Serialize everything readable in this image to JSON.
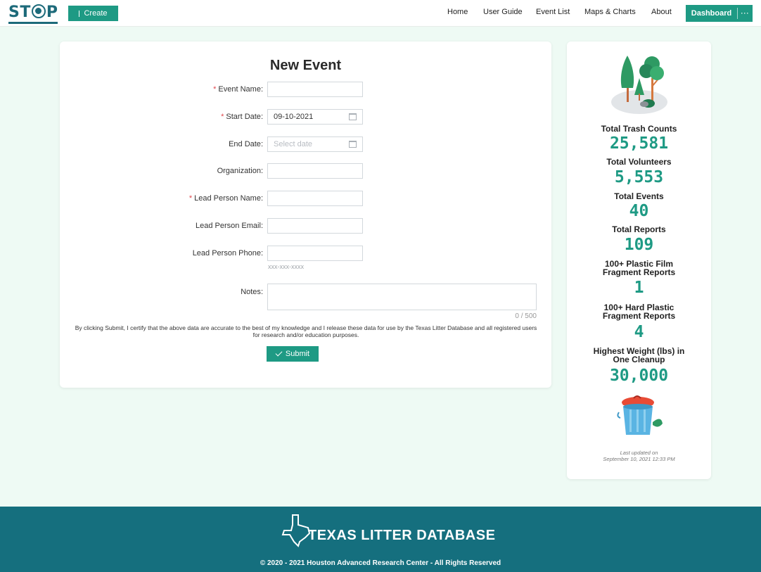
{
  "header": {
    "logo_text": "STOP",
    "create_label": "Create",
    "nav": [
      "Home",
      "User Guide",
      "Event List",
      "Maps & Charts",
      "About"
    ],
    "dashboard_label": "Dashboard",
    "more_label": "···"
  },
  "form": {
    "title": "New Event",
    "fields": [
      {
        "label": "Event Name",
        "required": true,
        "value": "",
        "placeholder": ""
      },
      {
        "label": "Start Date",
        "required": true,
        "value": "09-10-2021",
        "placeholder": ""
      },
      {
        "label": "End Date",
        "required": false,
        "value": "",
        "placeholder": "Select date"
      },
      {
        "label": "Organization",
        "required": false,
        "value": "",
        "placeholder": ""
      },
      {
        "label": "Lead Person Name",
        "required": true,
        "value": "",
        "placeholder": ""
      },
      {
        "label": "Lead Person Email",
        "required": false,
        "value": "",
        "placeholder": ""
      },
      {
        "label": "Lead Person Phone",
        "required": false,
        "value": "",
        "placeholder": ""
      }
    ],
    "phone_hint": "xxx-xxx-xxxx",
    "notes_label": "Notes",
    "notes_counter": "0 / 500",
    "disclaimer": "By clicking Submit, I certify that the above data are accurate to the best of my knowledge and I release these data for use by the Texas Litter Database and all registered users for research and/or education purposes.",
    "submit_label": "Submit"
  },
  "stats": [
    {
      "label": "Total Trash Counts",
      "value": "25,581"
    },
    {
      "label": "Total Volunteers",
      "value": "5,553"
    },
    {
      "label": "Total Events",
      "value": "40"
    },
    {
      "label": "Total Reports",
      "value": "109"
    },
    {
      "label": "100+ Plastic Film Fragment Reports",
      "value": "1"
    },
    {
      "label": "100+ Hard Plastic Fragment Reports",
      "value": "4"
    },
    {
      "label": "Highest Weight (lbs) in One Cleanup",
      "value": "30,000"
    }
  ],
  "updated": {
    "line1": "Last updated on",
    "line2": "September 10, 2021 12:33 PM"
  },
  "footer": {
    "title": "TEXAS LITTER DATABASE",
    "copyright": "© 2020 - 2021 Houston Advanced Research Center - All Rights Reserved"
  },
  "colors": {
    "accent": "#1e9a84",
    "brand": "#1d6a7a",
    "footer_bg": "#156f7e",
    "page_bg": "#eefaf4",
    "required": "#e0474c"
  }
}
